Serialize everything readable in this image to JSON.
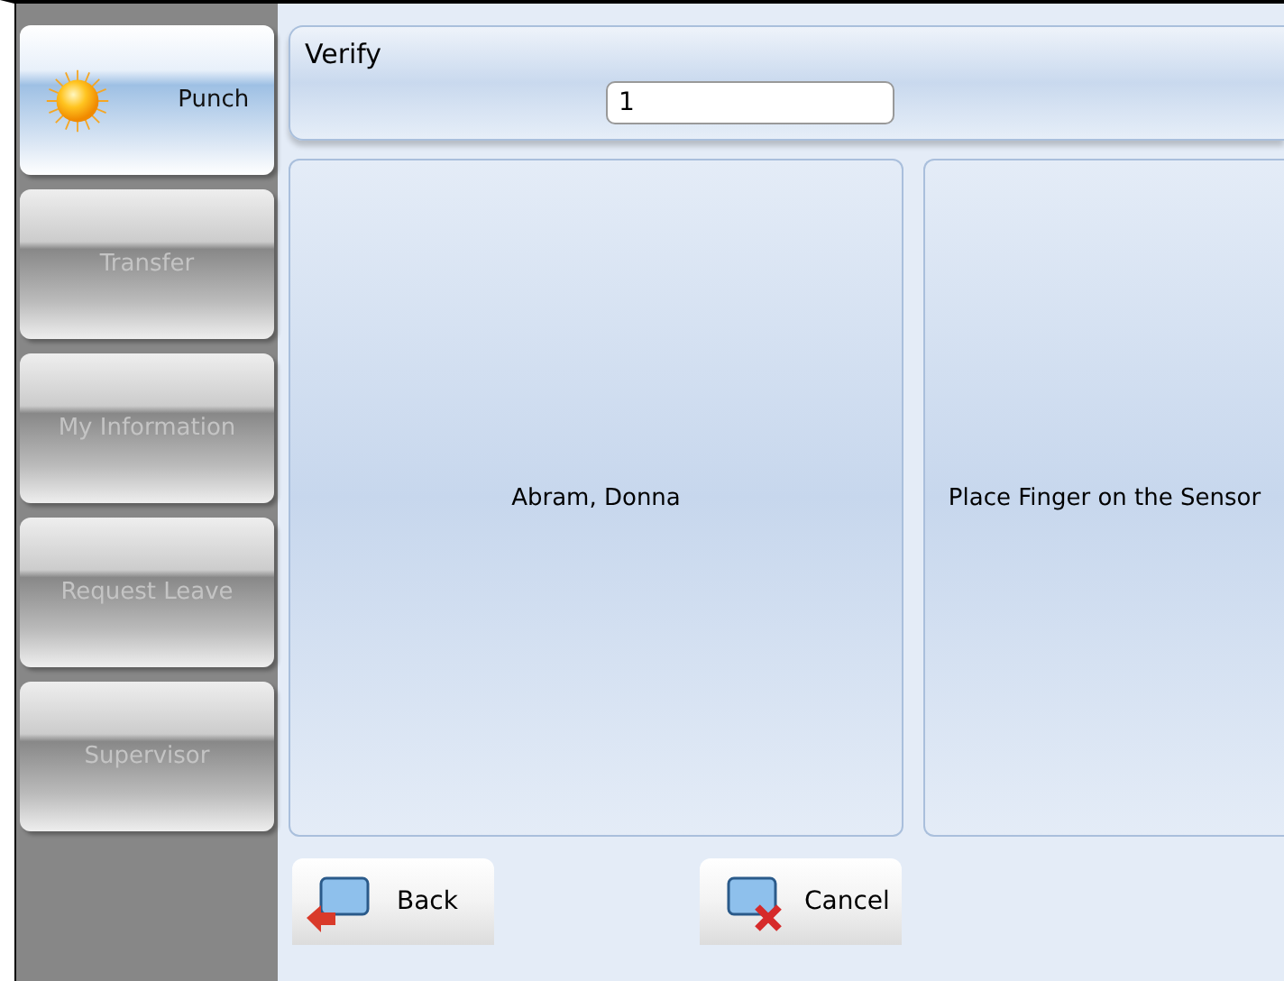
{
  "sidebar": {
    "items": [
      {
        "label": "Punch",
        "selected": true,
        "disabled": false
      },
      {
        "label": "Transfer",
        "selected": false,
        "disabled": true
      },
      {
        "label": "My Information",
        "selected": false,
        "disabled": true
      },
      {
        "label": "Request Leave",
        "selected": false,
        "disabled": true
      },
      {
        "label": "Supervisor",
        "selected": false,
        "disabled": true
      }
    ]
  },
  "verify": {
    "title": "Verify",
    "value": "1"
  },
  "panels": [
    {
      "text": "Abram, Donna"
    },
    {
      "text": "Place Finger on the Sensor"
    }
  ],
  "buttons": [
    {
      "label": "Back",
      "kind": "back"
    },
    {
      "label": "Cancel",
      "kind": "cancel"
    }
  ]
}
